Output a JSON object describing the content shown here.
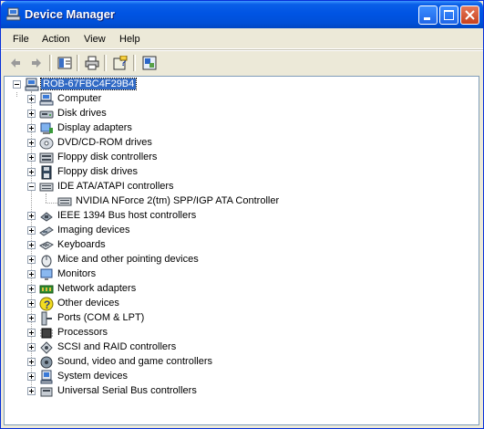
{
  "window": {
    "title": "Device Manager"
  },
  "menu": [
    "File",
    "Action",
    "View",
    "Help"
  ],
  "toolbar": {
    "icons": [
      "back-arrow-icon",
      "forward-arrow-icon",
      "show-hide-tree-icon",
      "print-icon",
      "help-properties-icon",
      "update-driver-icon"
    ]
  },
  "tree": {
    "root": {
      "label": "ROB-67FBC4F29B4",
      "icon": "computer-icon",
      "selected": true
    },
    "categories": [
      {
        "label": "Computer",
        "icon": "computer-icon",
        "expanded": false
      },
      {
        "label": "Disk drives",
        "icon": "disk-drive-icon",
        "expanded": false
      },
      {
        "label": "Display adapters",
        "icon": "display-adapter-icon",
        "expanded": false
      },
      {
        "label": "DVD/CD-ROM drives",
        "icon": "cdrom-icon",
        "expanded": false
      },
      {
        "label": "Floppy disk controllers",
        "icon": "floppy-controller-icon",
        "expanded": false
      },
      {
        "label": "Floppy disk drives",
        "icon": "floppy-drive-icon",
        "expanded": false
      },
      {
        "label": "IDE ATA/ATAPI controllers",
        "icon": "ide-controller-icon",
        "expanded": true,
        "children": [
          {
            "label": "NVIDIA NForce 2(tm) SPP/IGP ATA Controller",
            "icon": "ide-controller-icon"
          }
        ]
      },
      {
        "label": "IEEE 1394 Bus host controllers",
        "icon": "ieee1394-icon",
        "expanded": false
      },
      {
        "label": "Imaging devices",
        "icon": "imaging-device-icon",
        "expanded": false
      },
      {
        "label": "Keyboards",
        "icon": "keyboard-icon",
        "expanded": false
      },
      {
        "label": "Mice and other pointing devices",
        "icon": "mouse-icon",
        "expanded": false
      },
      {
        "label": "Monitors",
        "icon": "monitor-icon",
        "expanded": false
      },
      {
        "label": "Network adapters",
        "icon": "network-adapter-icon",
        "expanded": false
      },
      {
        "label": "Other devices",
        "icon": "question-mark-icon",
        "expanded": false
      },
      {
        "label": "Ports (COM & LPT)",
        "icon": "port-icon",
        "expanded": false
      },
      {
        "label": "Processors",
        "icon": "processor-icon",
        "expanded": false
      },
      {
        "label": "SCSI and RAID controllers",
        "icon": "scsi-controller-icon",
        "expanded": false
      },
      {
        "label": "Sound, video and game controllers",
        "icon": "sound-icon",
        "expanded": false
      },
      {
        "label": "System devices",
        "icon": "system-device-icon",
        "expanded": false
      },
      {
        "label": "Universal Serial Bus controllers",
        "icon": "usb-icon",
        "expanded": false
      }
    ]
  },
  "colors": {
    "titlebar": "#0054e3",
    "selection": "#316ac5",
    "chrome": "#ece9d8"
  }
}
